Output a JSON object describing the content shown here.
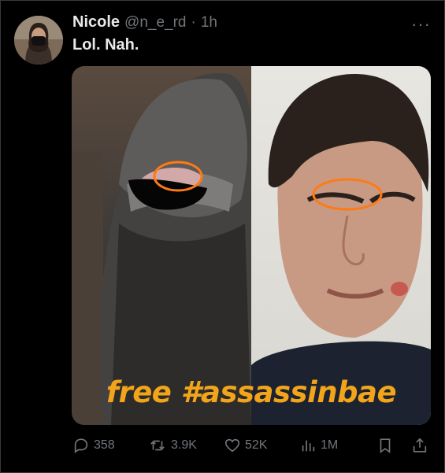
{
  "tweet": {
    "author_name": "Nicole",
    "author_handle": "@n_e_rd",
    "separator": "·",
    "time": "1h",
    "more_label": "···",
    "text": "Lol. Nah.",
    "media_caption": "free #assassinbae"
  },
  "actions": {
    "replies": "358",
    "reposts": "3.9K",
    "likes": "52K",
    "views": "1M"
  },
  "colors": {
    "background": "#000000",
    "text": "#e7e9ea",
    "muted": "#71767b",
    "caption": "#f2a51a",
    "annotation": "#ff7a12"
  },
  "icons": [
    "reply-icon",
    "repost-icon",
    "like-icon",
    "views-icon",
    "bookmark-icon",
    "share-icon"
  ]
}
